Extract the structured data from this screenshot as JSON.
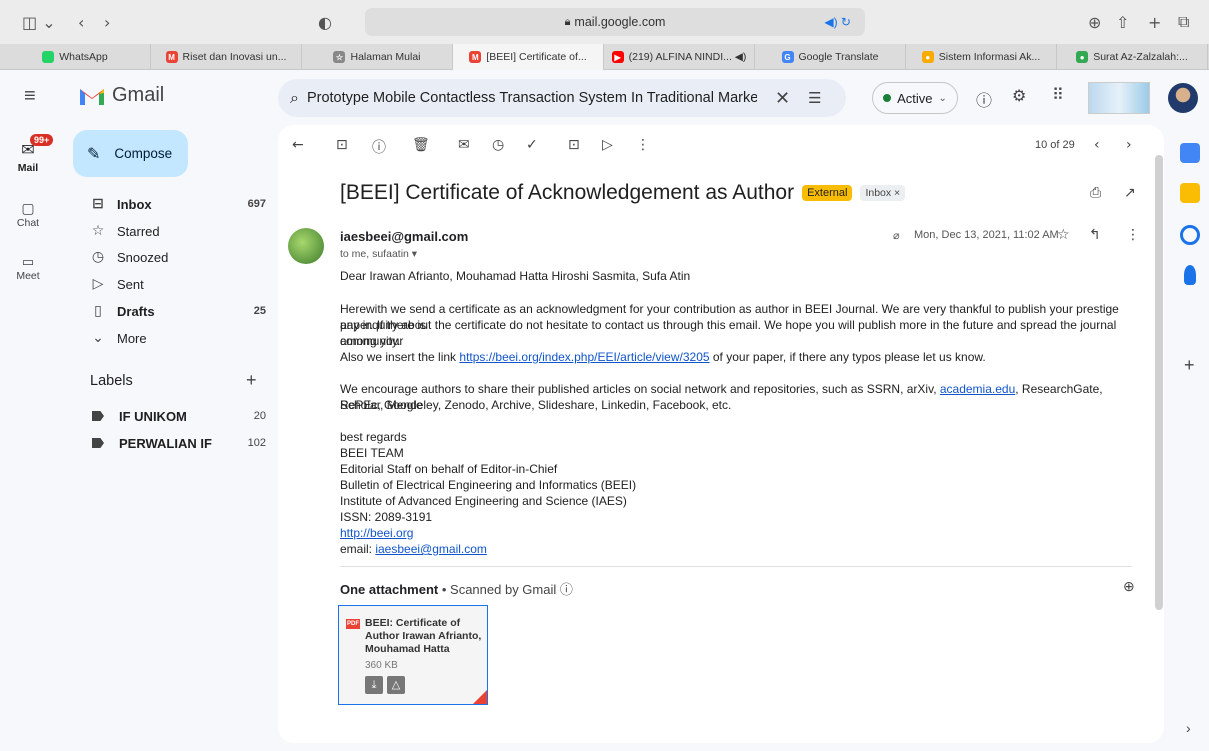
{
  "browser": {
    "url": "mail.google.com",
    "tabs": [
      {
        "label": "WhatsApp",
        "color": "#25d366"
      },
      {
        "label": "Riset dan Inovasi un...",
        "color": "#ea4335",
        "icon": "M"
      },
      {
        "label": "Halaman Mulai",
        "color": "#888888",
        "icon": "☆"
      },
      {
        "label": "[BEEI] Certificate of...",
        "color": "#ea4335",
        "icon": "M"
      },
      {
        "label": "(219) ALFINA NINDI... ◀︎)",
        "color": "#ff0000",
        "icon": "▶"
      },
      {
        "label": "Google Translate",
        "color": "#4285f4",
        "icon": "G"
      },
      {
        "label": "Sistem Informasi Ak...",
        "color": "#f9ab00",
        "icon": "●"
      },
      {
        "label": "Surat Az-Zalzalah:...",
        "color": "#34a853",
        "icon": "●"
      }
    ]
  },
  "header": {
    "app_name": "Gmail",
    "search_value": "Prototype Mobile Contactless Transaction System In Traditional Markets To :",
    "status": "Active"
  },
  "rail": {
    "mail_badge": "99+",
    "mail": "Mail",
    "chat": "Chat",
    "meet": "Meet"
  },
  "nav": {
    "compose": "Compose",
    "items": [
      {
        "label": "Inbox",
        "count": "697",
        "icon": "⊟"
      },
      {
        "label": "Starred",
        "count": "",
        "icon": "☆"
      },
      {
        "label": "Snoozed",
        "count": "",
        "icon": "◷"
      },
      {
        "label": "Sent",
        "count": "",
        "icon": "▷"
      },
      {
        "label": "Drafts",
        "count": "25",
        "icon": "▯"
      },
      {
        "label": "More",
        "count": "",
        "icon": "⌄"
      }
    ],
    "labels_title": "Labels",
    "labels": [
      {
        "label": "IF UNIKOM",
        "count": "20"
      },
      {
        "label": "PERWALIAN IF",
        "count": "102"
      }
    ]
  },
  "message": {
    "pager": "10 of 29",
    "subject": "[BEEI] Certificate of Acknowledgement as Author",
    "badge_external": "External",
    "badge_inbox": "Inbox ×",
    "sender": "iaesbeei@gmail.com",
    "to": "to me, sufaatin ▾",
    "date": "Mon, Dec 13, 2021, 11:02 AM",
    "greeting": "Dear Irawan Afrianto, Mouhamad Hatta Hiroshi Sasmita, Sufa Atin",
    "para1_l1": "Herewith we send a certificate as an acknowledgment for your contribution as author in BEEI Journal. We are very thankful to publish your prestige paper. If there is",
    "para1_l2": "any inquiry about the certificate do not hesitate to contact us through this email. We hope you will publish more in the future and spread the journal among your",
    "para1_l3": "community.",
    "para2_pre": "Also we insert the link ",
    "para2_link": "https://beei.org/index.php/EEI/article/view/3205",
    "para2_post": " of your paper, if there any typos please let us know.",
    "para3_pre": "We encourage authors to share their published articles on social network and repositories, such as SSRN, arXiv, ",
    "para3_link": "academia.edu",
    "para3_post": ", ResearchGate, RePEc, Google",
    "para3_l2": "Scholar, Mendeley, Zenodo, Archive, Slideshare, Linkedin, Facebook, etc.",
    "sig1": "best regards",
    "sig2": "BEEI TEAM",
    "sig3": "Editorial Staff on behalf of Editor-in-Chief",
    "sig4": "Bulletin of Electrical Engineering and Informatics (BEEI)",
    "sig5": "Institute of Advanced Engineering and Science (IAES)",
    "sig6": "ISSN: 2089-3191",
    "sig7": "http://beei.org",
    "sig8_pre": "email: ",
    "sig8_link": "iaesbeei@gmail.com",
    "att_title": "One attachment",
    "att_scanned": " • Scanned by Gmail ⓘ",
    "att_name": "BEEI: Certificate of Author Irawan Afrianto, Mouhamad Hatta",
    "att_size": "360 KB",
    "att_type": "PDF"
  }
}
